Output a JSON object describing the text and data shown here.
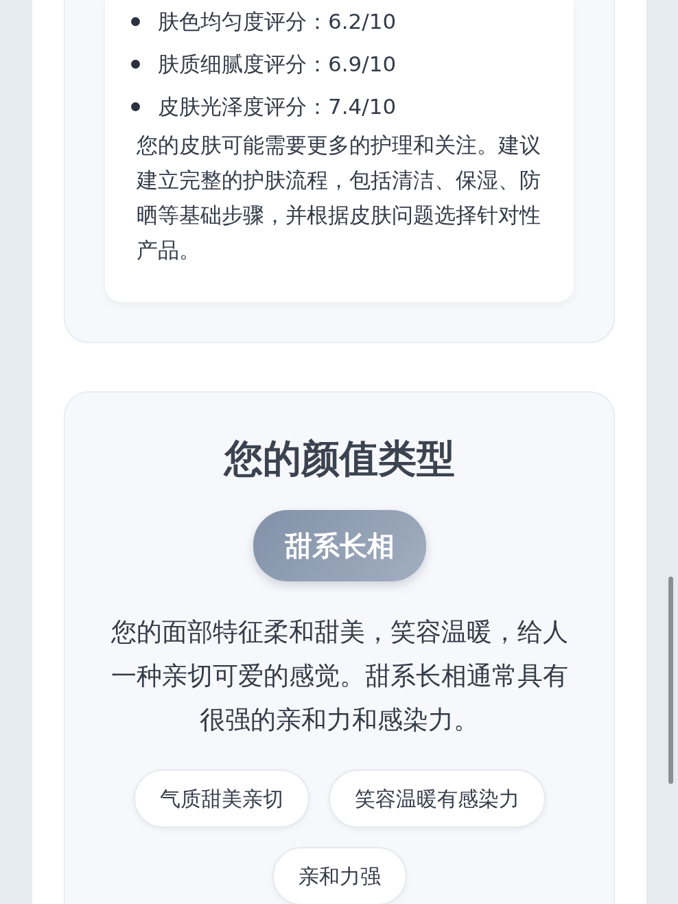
{
  "skin_scores": [
    "肤色均匀度评分：6.2/10",
    "肤质细腻度评分：6.9/10",
    "皮肤光泽度评分：7.4/10"
  ],
  "skin_advice": "您的皮肤可能需要更多的护理和关注。建议建立完整的护肤流程，包括清洁、保湿、防晒等基础步骤，并根据皮肤问题选择针对性产品。",
  "beauty_type": {
    "title": "您的颜值类型",
    "type_badge": "甜系长相",
    "description": "您的面部特征柔和甜美，笑容温暖，给人一种亲切可爱的感觉。甜系长相通常具有很强的亲和力和感染力。",
    "tags": [
      "气质甜美亲切",
      "笑容温暖有感染力",
      "亲和力强"
    ]
  }
}
